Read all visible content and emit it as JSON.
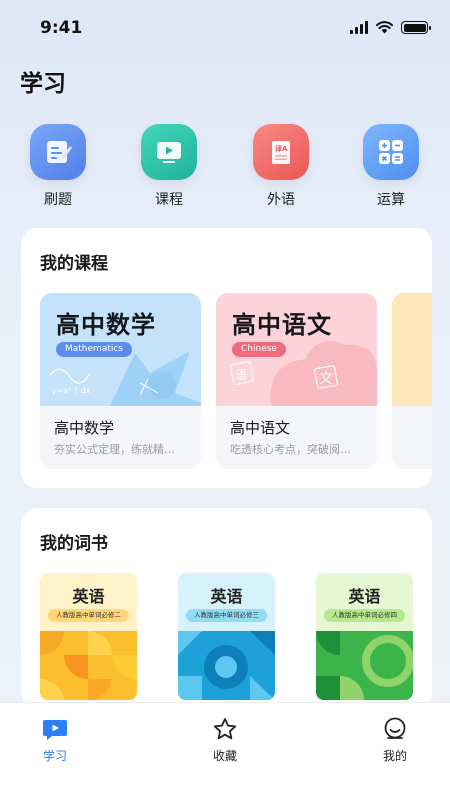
{
  "status_bar": {
    "time": "9:41"
  },
  "page_title": "学习",
  "quick_actions": [
    {
      "label": "刷题",
      "icon": "practice-edit-icon",
      "color": "#5b8def"
    },
    {
      "label": "课程",
      "icon": "video-play-icon",
      "color": "#27c4a8"
    },
    {
      "label": "外语",
      "icon": "translate-book-icon",
      "color": "#f06a68"
    },
    {
      "label": "运算",
      "icon": "calculator-icon",
      "color": "#5aa0f5"
    }
  ],
  "my_courses": {
    "title": "我的课程",
    "items": [
      {
        "banner_title": "高中数学",
        "tag": "Mathematics",
        "name": "高中数学",
        "desc": "夯实公式定理，练就精…",
        "bg": "#bfe1fb",
        "tag_color": "#5b8def"
      },
      {
        "banner_title": "高中语文",
        "tag": "Chinese",
        "name": "高中语文",
        "desc": "吃透核心考点，突破阅…",
        "bg": "#fcd5da",
        "tag_color": "#f06a7d"
      }
    ]
  },
  "my_wordbooks": {
    "title": "我的词书",
    "items": [
      {
        "title": "英语",
        "subtitle": "人教版高中单词必修二",
        "top_bg": "#fff1c8",
        "sub_bg": "#ffd77a",
        "pattern": "yellow"
      },
      {
        "title": "英语",
        "subtitle": "人教版高中单词必修三",
        "top_bg": "#d5f1fb",
        "sub_bg": "#8fdcf3",
        "pattern": "blue"
      },
      {
        "title": "英语",
        "subtitle": "人教版高中单词必修四",
        "top_bg": "#e6f8d2",
        "sub_bg": "#b5e98c",
        "pattern": "green"
      }
    ]
  },
  "tab_bar": {
    "items": [
      {
        "label": "学习",
        "icon": "study-play-icon",
        "active": true
      },
      {
        "label": "收藏",
        "icon": "star-icon",
        "active": false
      },
      {
        "label": "我的",
        "icon": "profile-icon",
        "active": false
      }
    ],
    "active_color": "#2c7ef8"
  }
}
